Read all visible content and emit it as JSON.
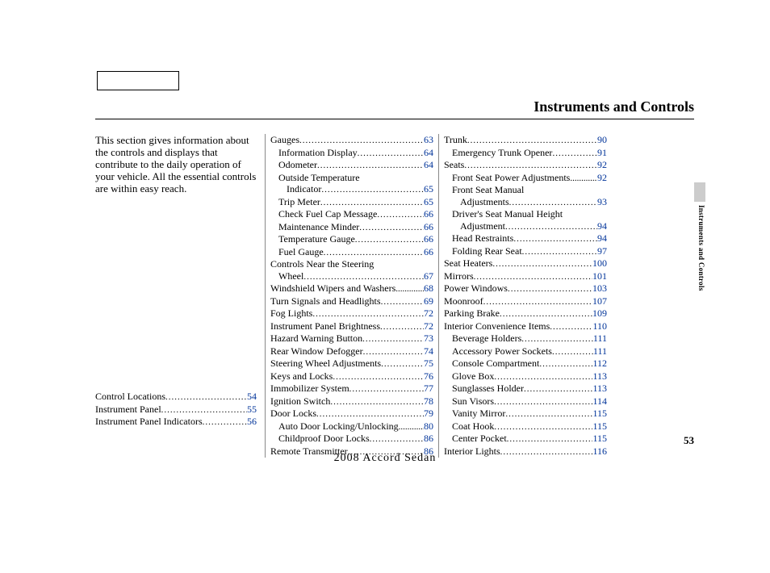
{
  "title": "Instruments and Controls",
  "intro": "This section gives information about the controls and displays that contribute to the daily operation of your vehicle. All the essential controls are within easy reach.",
  "side_label": "Instruments and Controls",
  "page_number": "53",
  "footer": "2008  Accord  Sedan",
  "col1": [
    {
      "label": "Control Locations",
      "page": "54",
      "indent": 0
    },
    {
      "label": "Instrument Panel",
      "page": "55",
      "indent": 0
    },
    {
      "label": "Instrument Panel Indicators",
      "page": "56",
      "indent": 0
    }
  ],
  "col2": [
    {
      "label": "Gauges",
      "page": "63",
      "indent": 0
    },
    {
      "label": "Information Display",
      "page": "64",
      "indent": 1
    },
    {
      "label": "Odometer",
      "page": "64",
      "indent": 1
    },
    {
      "label": "Outside Temperature",
      "page": "",
      "indent": 1,
      "nowrapPage": true
    },
    {
      "label": "Indicator",
      "page": "65",
      "indent": 2
    },
    {
      "label": "Trip Meter",
      "page": "65",
      "indent": 1
    },
    {
      "label": "Check Fuel Cap Message",
      "page": "66",
      "indent": 1
    },
    {
      "label": "Maintenance Minder",
      "page": "66",
      "indent": 1
    },
    {
      "label": "Temperature Gauge",
      "page": "66",
      "indent": 1
    },
    {
      "label": "Fuel Gauge",
      "page": "66",
      "indent": 1
    },
    {
      "label": "Controls Near the Steering",
      "page": "",
      "indent": 0,
      "nowrapPage": true
    },
    {
      "label": "Wheel",
      "page": "67",
      "indent": 1
    },
    {
      "label": "Windshield Wipers and Washers",
      "page": "68",
      "indent": 0,
      "tight": true
    },
    {
      "label": "Turn Signals and Headlights",
      "page": "69",
      "indent": 0
    },
    {
      "label": "Fog Lights",
      "page": "72",
      "indent": 0
    },
    {
      "label": "Instrument Panel Brightness",
      "page": "72",
      "indent": 0
    },
    {
      "label": "Hazard Warning Button",
      "page": "73",
      "indent": 0
    },
    {
      "label": "Rear Window Defogger",
      "page": "74",
      "indent": 0
    },
    {
      "label": "Steering Wheel Adjustments",
      "page": "75",
      "indent": 0
    },
    {
      "label": "Keys and Locks",
      "page": "76",
      "indent": 0
    },
    {
      "label": "Immobilizer System",
      "page": "77",
      "indent": 0
    },
    {
      "label": "Ignition Switch",
      "page": "78",
      "indent": 0
    },
    {
      "label": "Door Locks",
      "page": "79",
      "indent": 0
    },
    {
      "label": "Auto Door Locking/Unlocking",
      "page": "80",
      "indent": 1,
      "tight": true
    },
    {
      "label": "Childproof Door Locks",
      "page": "86",
      "indent": 1
    },
    {
      "label": "Remote Transmitter",
      "page": "86",
      "indent": 0
    }
  ],
  "col3": [
    {
      "label": "Trunk",
      "page": "90",
      "indent": 0
    },
    {
      "label": "Emergency Trunk Opener",
      "page": "91",
      "indent": 1
    },
    {
      "label": "Seats",
      "page": "92",
      "indent": 0
    },
    {
      "label": "Front Seat Power Adjustments",
      "page": "92",
      "indent": 1,
      "tight": true
    },
    {
      "label": "Front Seat Manual",
      "page": "",
      "indent": 1,
      "nowrapPage": true
    },
    {
      "label": "Adjustments",
      "page": "93",
      "indent": 2
    },
    {
      "label": "Driver's Seat Manual Height",
      "page": "",
      "indent": 1,
      "nowrapPage": true
    },
    {
      "label": "Adjustment",
      "page": "94",
      "indent": 2
    },
    {
      "label": "Head Restraints",
      "page": "94",
      "indent": 1
    },
    {
      "label": "Folding Rear Seat",
      "page": "97",
      "indent": 1
    },
    {
      "label": "Seat Heaters",
      "page": "100",
      "indent": 0
    },
    {
      "label": "Mirrors",
      "page": "101",
      "indent": 0
    },
    {
      "label": "Power Windows",
      "page": "103",
      "indent": 0
    },
    {
      "label": "Moonroof",
      "page": "107",
      "indent": 0
    },
    {
      "label": "Parking Brake",
      "page": "109",
      "indent": 0
    },
    {
      "label": "Interior Convenience Items",
      "page": "110",
      "indent": 0
    },
    {
      "label": "Beverage Holders",
      "page": "111",
      "indent": 1
    },
    {
      "label": "Accessory Power Sockets",
      "page": "111",
      "indent": 1
    },
    {
      "label": "Console Compartment",
      "page": "112",
      "indent": 1
    },
    {
      "label": "Glove Box",
      "page": "113",
      "indent": 1
    },
    {
      "label": "Sunglasses Holder",
      "page": "113",
      "indent": 1
    },
    {
      "label": "Sun Visors",
      "page": "114",
      "indent": 1
    },
    {
      "label": "Vanity Mirror",
      "page": "115",
      "indent": 1
    },
    {
      "label": "Coat Hook",
      "page": "115",
      "indent": 1
    },
    {
      "label": "Center Pocket",
      "page": "115",
      "indent": 1
    },
    {
      "label": "Interior Lights",
      "page": "116",
      "indent": 0
    }
  ]
}
